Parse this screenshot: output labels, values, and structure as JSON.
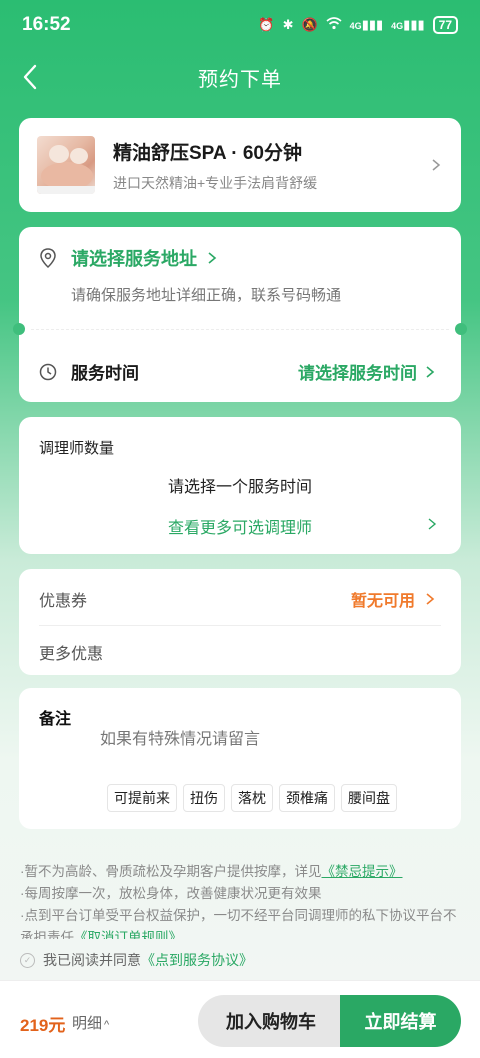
{
  "status_bar": {
    "time": "16:52",
    "battery": "77",
    "network_1": "4G",
    "network_2": "4G"
  },
  "nav": {
    "title": "预约下单"
  },
  "product": {
    "name": "精油舒压SPA · 60分钟",
    "desc": "进口天然精油+专业手法肩背舒缓"
  },
  "address": {
    "label": "请选择服务地址",
    "hint": "请确保服务地址详细正确，联系号码畅通"
  },
  "service_time": {
    "label": "服务时间",
    "value": "请选择服务时间"
  },
  "therapist": {
    "title": "调理师数量",
    "message": "请选择一个服务时间",
    "more": "查看更多可选调理师"
  },
  "coupon": {
    "label": "优惠券",
    "value": "暂无可用",
    "more_label": "更多优惠"
  },
  "remark": {
    "label": "备注",
    "placeholder": "如果有特殊情况请留言",
    "tags": [
      "可提前来",
      "扭伤",
      "落枕",
      "颈椎痛",
      "腰间盘"
    ]
  },
  "notice": {
    "line1": "·暂不为高龄、骨质疏松及孕期客户提供按摩，详见",
    "line1_link": "《禁忌提示》",
    "line2": "·每周按摩一次，放松身体，改善健康状况更有效果",
    "line3": "·点到平台订单受平台权益保护，一切不经平台同调理师的私下协议平台不承担责任",
    "line3_link": "《取消订单规则》"
  },
  "agreement": {
    "prefix": "我已阅读并同意",
    "link": "《点到服务协议》"
  },
  "bottom": {
    "price": "219元",
    "detail": "明细",
    "cart_button": "加入购物车",
    "pay_button": "立即结算"
  },
  "colors": {
    "brand_green": "#2aa864",
    "header_green": "#2bbd72",
    "price_orange": "#e2621b",
    "coupon_orange": "#f07a2c"
  }
}
